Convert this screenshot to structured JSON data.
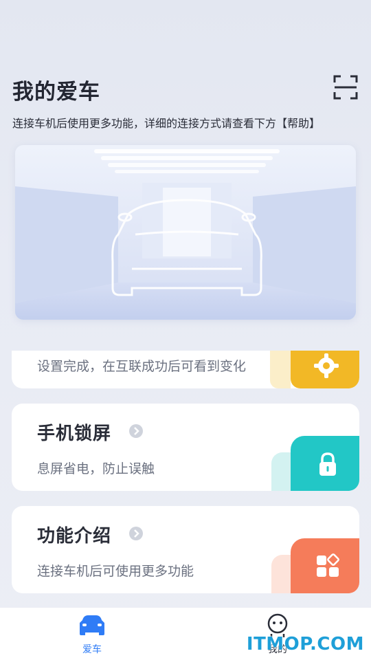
{
  "header": {
    "title": "我的爱车",
    "subtitle": "连接车机后使用更多功能，详细的连接方式请查看下方【帮助】",
    "scan_icon": "scan-icon"
  },
  "cards": [
    {
      "id": "partial",
      "desc": "设置完成，在互联成功后可看到变化",
      "icon": "gear-icon",
      "color": "#f2b826"
    },
    {
      "id": "lock",
      "title": "手机锁屏",
      "desc": "息屏省电，防止误触",
      "icon": "lock-icon",
      "color": "#22c7c6"
    },
    {
      "id": "features",
      "title": "功能介绍",
      "desc": "连接车机后可使用更多功能",
      "icon": "apps-icon",
      "color": "#f57c5a"
    }
  ],
  "tabbar": {
    "items": [
      {
        "label": "爱车",
        "icon": "car-icon",
        "active": true
      },
      {
        "label": "我的",
        "icon": "profile-icon",
        "active": false
      }
    ],
    "active_color": "#2f7cf6"
  },
  "watermark": "ITMOP.COM"
}
